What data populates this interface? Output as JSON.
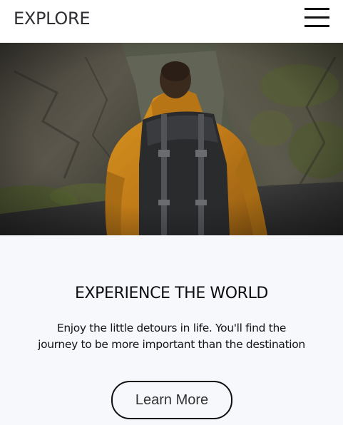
{
  "navbar": {
    "brand": "EXPLORE",
    "menu_icon": "hamburger-menu-icon"
  },
  "hero": {
    "image_description_icon": "hiker-with-backpack-photo"
  },
  "main": {
    "headline": "EXPERIENCE THE WORLD",
    "tagline_line1": "Enjoy the little detours in life. You'll find the",
    "tagline_line2": "journey to be more important than the destination",
    "cta_label": "Learn More"
  },
  "colors": {
    "background": "#f7f8fc",
    "navbar": "#ffffff",
    "text": "#0d0d0f",
    "jacket": "#c9871e"
  }
}
